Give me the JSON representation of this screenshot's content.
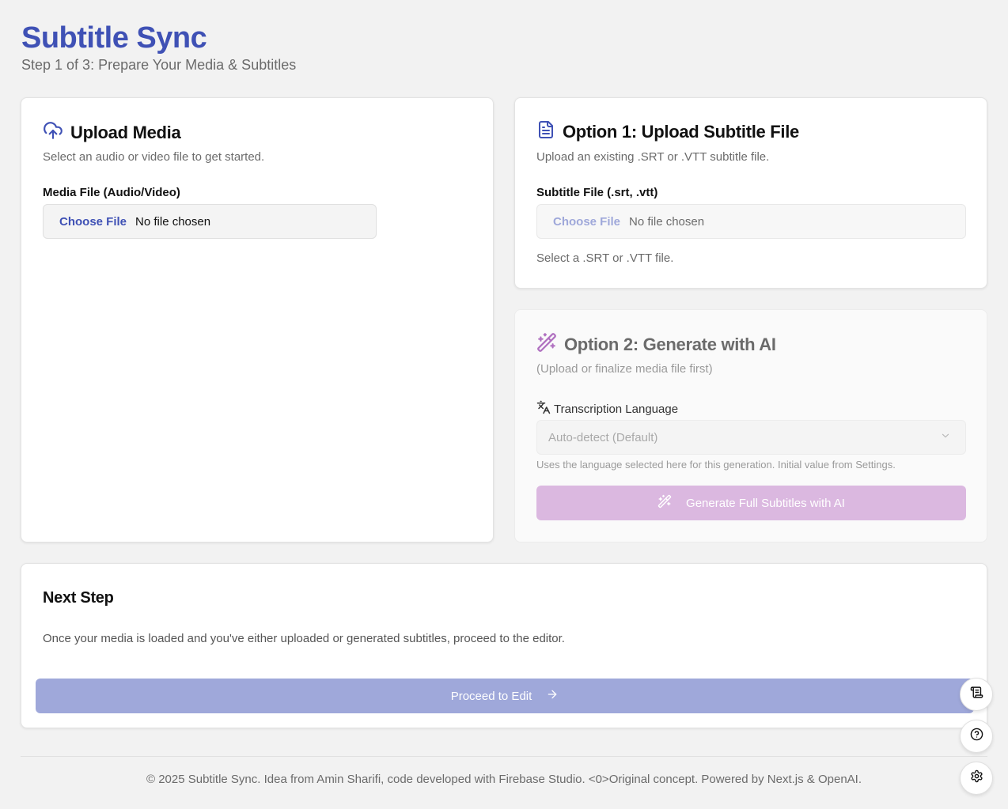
{
  "header": {
    "title": "Subtitle Sync",
    "subtitle": "Step 1 of 3: Prepare Your Media & Subtitles"
  },
  "upload_media": {
    "icon": "cloud-upload-icon",
    "title": "Upload Media",
    "description": "Select an audio or video file to get started.",
    "field_label": "Media File (Audio/Video)",
    "file_button": "Choose File",
    "file_status": "No file chosen"
  },
  "subtitle_file": {
    "icon": "file-text-icon",
    "title": "Option 1: Upload Subtitle File",
    "description": "Upload an existing .SRT or .VTT subtitle file.",
    "field_label": "Subtitle File (.srt, .vtt)",
    "file_button": "Choose File",
    "file_status": "No file chosen",
    "hint": "Select a .SRT or .VTT file."
  },
  "generate_ai": {
    "icon": "magic-wand-icon",
    "title": "Option 2: Generate with AI",
    "description": "(Upload or finalize media file first)",
    "language_label": "Transcription Language",
    "language_icon": "translate-icon",
    "language_selected": "Auto-detect (Default)",
    "language_note": "Uses the language selected here for this generation. Initial value from Settings.",
    "generate_button": "Generate Full Subtitles with AI"
  },
  "next_step": {
    "title": "Next Step",
    "description": "Once your media is loaded and you've either uploaded or generated subtitles, proceed to the editor.",
    "proceed_button": "Proceed to Edit"
  },
  "footer": {
    "text": "© 2025 Subtitle Sync. Idea from Amin Sharifi, code developed with Firebase Studio. <0>Original concept. Powered by Next.js & OpenAI."
  },
  "colors": {
    "brand": "#3f51b5",
    "brand_light": "#9fa8da",
    "ai_accent": "#dbb8e0"
  }
}
